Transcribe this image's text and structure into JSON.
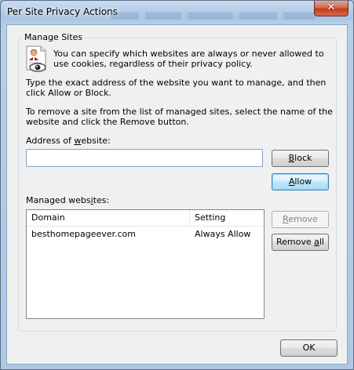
{
  "window": {
    "title": "Per Site Privacy Actions",
    "close_glyph": "✕"
  },
  "group": {
    "label": "Manage Sites",
    "icon": "privacy-document-eye-icon",
    "intro_text": "You can specify which websites are always or never allowed to use cookies, regardless of their privacy policy.",
    "type_instruction": "Type the exact address of the website you want to manage, and then click Allow or Block.",
    "remove_instruction": "To remove a site from the list of managed sites, select the name of the website and click the Remove button."
  },
  "address": {
    "label_pre": "Address of ",
    "label_mnemonic": "w",
    "label_post": "ebsite:",
    "value": "",
    "placeholder": ""
  },
  "buttons": {
    "block_mnemonic": "B",
    "block_rest": "lock",
    "allow_mnemonic": "A",
    "allow_rest": "llow",
    "remove_mnemonic": "R",
    "remove_rest": "emove",
    "remove_all_pre": "Remove ",
    "remove_all_mnemonic": "a",
    "remove_all_post": "ll",
    "ok": "OK"
  },
  "managed": {
    "label_pre": "Managed webs",
    "label_mnemonic": "i",
    "label_post": "tes:",
    "columns": [
      "Domain",
      "Setting"
    ],
    "rows": [
      {
        "domain": "besthomepageever.com",
        "setting": "Always Allow"
      }
    ]
  },
  "colors": {
    "window_frame": "#a9c4e2",
    "client_bg": "#f0f0f0",
    "close_button": "#c43c1c",
    "default_button_border": "#3c7fb1"
  }
}
